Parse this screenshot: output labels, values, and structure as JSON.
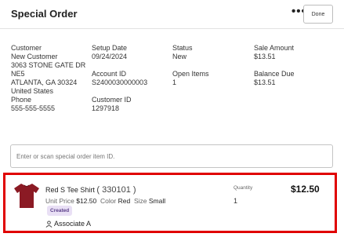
{
  "header": {
    "title": "Special Order",
    "more_icon": "more-horizontal-icon",
    "more_glyph": "•••",
    "done_label": "Done"
  },
  "customer": {
    "label": "Customer",
    "name": "New Customer",
    "address": [
      "3063 STONE GATE DR",
      "NE5",
      "ATLANTA, GA 30324",
      "United States"
    ],
    "phone_label": "Phone",
    "phone": "555-555-5555"
  },
  "setup": {
    "date_label": "Setup Date",
    "date": "09/24/2024",
    "account_label": "Account ID",
    "account": "S2400030000003",
    "customer_id_label": "Customer ID",
    "customer_id": "1297918"
  },
  "status": {
    "label": "Status",
    "value": "New",
    "open_items_label": "Open Items",
    "open_items": "1"
  },
  "amounts": {
    "sale_label": "Sale Amount",
    "sale": "$13.51",
    "balance_label": "Balance Due",
    "balance": "$13.51"
  },
  "search": {
    "placeholder": "Enter or scan special order item ID."
  },
  "item": {
    "name": "Red S Tee Shirt",
    "sku": "( 330101 )",
    "unit_price_label": "Unit Price",
    "unit_price": "$12.50",
    "color_label": "Color",
    "color": "Red",
    "size_label": "Size",
    "size": "Small",
    "status_badge": "Created",
    "associate": "Associate A",
    "associate_icon": "person-icon",
    "quantity_label": "Quantity",
    "quantity": "1",
    "price": "$12.50",
    "thumb_color": "#8b1a24",
    "highlight_color": "#e00000"
  }
}
